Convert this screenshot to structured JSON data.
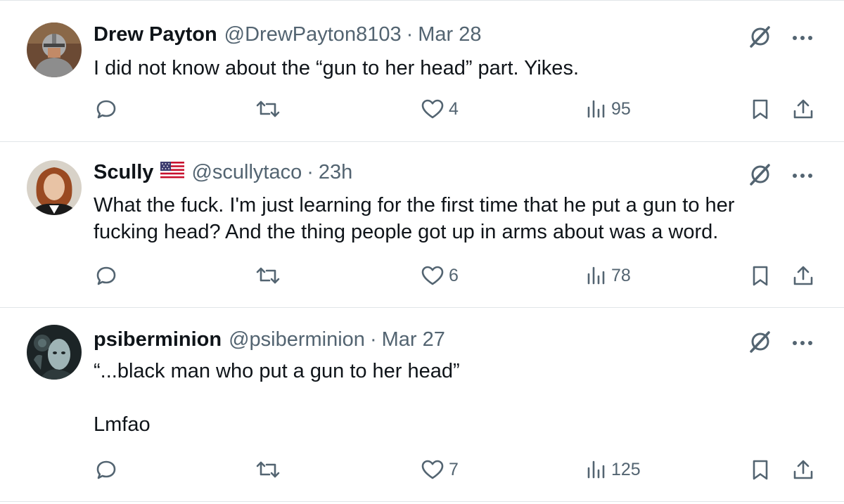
{
  "tweets": [
    {
      "name": "Drew Payton",
      "handle": "@DrewPayton8103",
      "dot": "·",
      "time": "Mar 28",
      "text": "I did not know about the “gun to her head” part. Yikes.",
      "likes": "4",
      "views": "95",
      "avatar": "knight-helmet-avatar"
    },
    {
      "name": "Scully",
      "handle": "@scullytaco",
      "dot": "·",
      "time": "23h",
      "text": "What the fuck. I'm just learning for the first time that he put a gun to her\nfucking head? And the thing people got up in arms about was a word.",
      "likes": "6",
      "views": "78",
      "avatar": "red-haired-woman-avatar",
      "badge": "us-flag-icon"
    },
    {
      "name": "psiberminion",
      "handle": "@psiberminion",
      "dot": "·",
      "time": "Mar 27",
      "text": "“...black man who put a gun to her head”\n\nLmfao",
      "likes": "7",
      "views": "125",
      "avatar": "cyborg-avatar"
    }
  ],
  "icons": {
    "grok": "grok-icon",
    "more": "more-icon",
    "reply": "reply-icon",
    "retweet": "retweet-icon",
    "like": "like-icon",
    "views": "views-icon",
    "bookmark": "bookmark-icon",
    "share": "share-icon"
  },
  "colors": {
    "text": "#0f1419",
    "secondary": "#536471",
    "divider": "#e1e5e8"
  }
}
